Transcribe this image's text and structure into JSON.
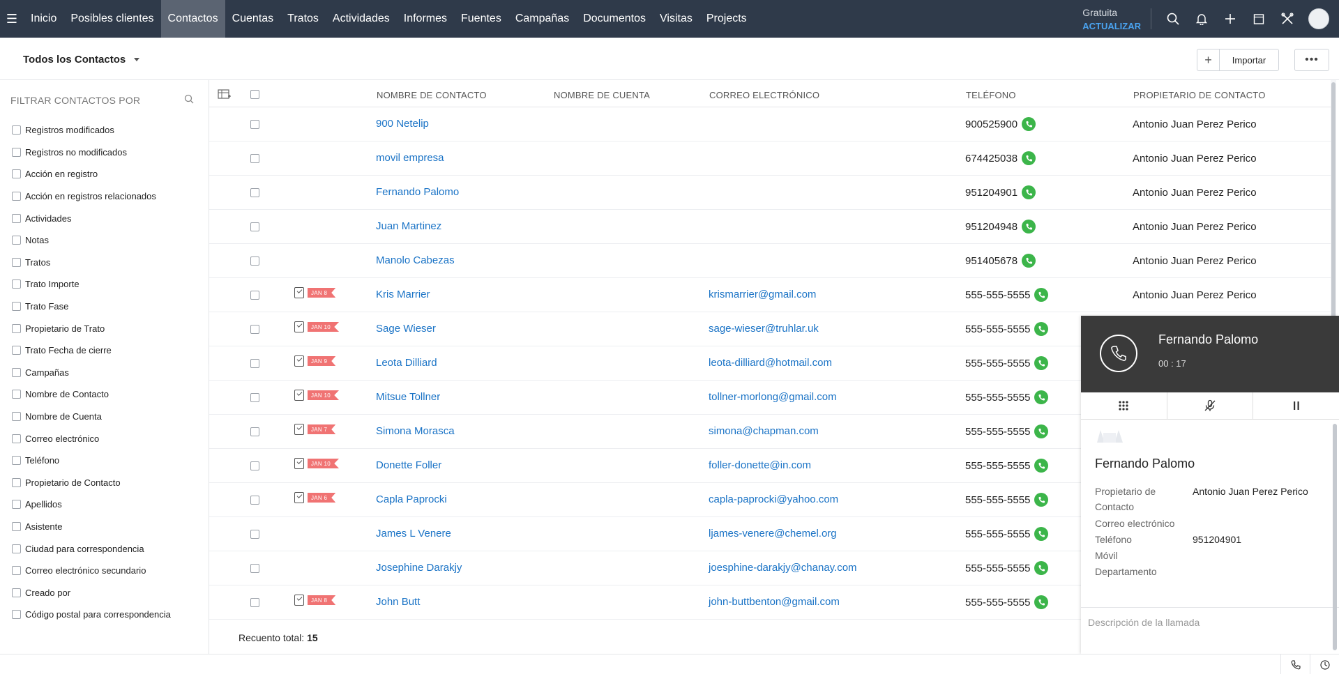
{
  "nav": {
    "tabs": [
      "Inicio",
      "Posibles clientes",
      "Contactos",
      "Cuentas",
      "Tratos",
      "Actividades",
      "Informes",
      "Fuentes",
      "Campañas",
      "Documentos",
      "Visitas",
      "Projects"
    ],
    "active_tab": "Contactos",
    "plan": "Gratuita",
    "upgrade": "ACTUALIZAR",
    "icons": [
      "search-icon",
      "bell-icon",
      "plus-icon",
      "calendar-icon",
      "tools-icon",
      "avatar"
    ]
  },
  "subheader": {
    "view_name": "Todos los Contactos",
    "import_label": "Importar",
    "plus_label": "+",
    "more_label": "•••"
  },
  "sidebar": {
    "title": "FILTRAR CONTACTOS POR",
    "filters": [
      "Registros modificados",
      "Registros no modificados",
      "Acción en registro",
      "Acción en registros relacionados",
      "Actividades",
      "Notas",
      "Tratos",
      "Trato Importe",
      "Trato Fase",
      "Propietario de Trato",
      "Trato Fecha de cierre",
      "Campañas",
      "Nombre de Contacto",
      "Nombre de Cuenta",
      "Correo electrónico",
      "Teléfono",
      "Propietario de Contacto",
      "Apellidos",
      "Asistente",
      "Ciudad para correspondencia",
      "Correo electrónico secundario",
      "Creado por",
      "Código postal para correspondencia"
    ]
  },
  "table": {
    "headers": {
      "name": "NOMBRE DE CONTACTO",
      "account": "NOMBRE DE CUENTA",
      "email": "CORREO ELECTRÓNICO",
      "phone": "TELÉFONO",
      "owner": "PROPIETARIO DE CONTACTO"
    },
    "rows": [
      {
        "name": "900 Netelip",
        "task": "",
        "email": "",
        "phone": "900525900",
        "owner": "Antonio Juan Perez Perico"
      },
      {
        "name": "movil empresa",
        "task": "",
        "email": "",
        "phone": "674425038",
        "owner": "Antonio Juan Perez Perico"
      },
      {
        "name": "Fernando Palomo",
        "task": "",
        "email": "",
        "phone": "951204901",
        "owner": "Antonio Juan Perez Perico"
      },
      {
        "name": "Juan Martinez",
        "task": "",
        "email": "",
        "phone": "951204948",
        "owner": "Antonio Juan Perez Perico"
      },
      {
        "name": "Manolo Cabezas",
        "task": "",
        "email": "",
        "phone": "951405678",
        "owner": "Antonio Juan Perez Perico"
      },
      {
        "name": "Kris Marrier",
        "task": "JAN 8",
        "email": "krismarrier@gmail.com",
        "phone": "555-555-5555",
        "owner": "Antonio Juan Perez Perico"
      },
      {
        "name": "Sage Wieser",
        "task": "JAN 10",
        "email": "sage-wieser@truhlar.uk",
        "phone": "555-555-5555",
        "owner": ""
      },
      {
        "name": "Leota Dilliard",
        "task": "JAN 9",
        "email": "leota-dilliard@hotmail.com",
        "phone": "555-555-5555",
        "owner": ""
      },
      {
        "name": "Mitsue Tollner",
        "task": "JAN 10",
        "email": "tollner-morlong@gmail.com",
        "phone": "555-555-5555",
        "owner": ""
      },
      {
        "name": "Simona Morasca",
        "task": "JAN 7",
        "email": "simona@chapman.com",
        "phone": "555-555-5555",
        "owner": ""
      },
      {
        "name": "Donette Foller",
        "task": "JAN 10",
        "email": "foller-donette@in.com",
        "phone": "555-555-5555",
        "owner": ""
      },
      {
        "name": "Capla Paprocki",
        "task": "JAN 6",
        "email": "capla-paprocki@yahoo.com",
        "phone": "555-555-5555",
        "owner": ""
      },
      {
        "name": "James L Venere",
        "task": "",
        "email": "ljames-venere@chemel.org",
        "phone": "555-555-5555",
        "owner": ""
      },
      {
        "name": "Josephine Darakjy",
        "task": "",
        "email": "joesphine-darakjy@chanay.com",
        "phone": "555-555-5555",
        "owner": ""
      },
      {
        "name": "John Butt",
        "task": "JAN 8",
        "email": "john-buttbenton@gmail.com",
        "phone": "555-555-5555",
        "owner": ""
      }
    ],
    "total_label": "Recuento total:",
    "total_value": "15"
  },
  "call_panel": {
    "caller": "Fernando Palomo",
    "timer": "00 : 17",
    "contact_name": "Fernando Palomo",
    "fields": [
      {
        "label": "Propietario de",
        "label2": "Contacto",
        "value": "Antonio Juan Perez Perico"
      },
      {
        "label": "Correo electrónico",
        "label2": "",
        "value": ""
      },
      {
        "label": "Teléfono",
        "label2": "",
        "value": "951204901"
      },
      {
        "label": "Móvil",
        "label2": "",
        "value": ""
      },
      {
        "label": "Departamento",
        "label2": "",
        "value": ""
      }
    ],
    "description_placeholder": "Descripción de la llamada"
  },
  "colors": {
    "nav_bg": "#2f3a4a",
    "link": "#1a73c6",
    "phone_green": "#3cb54a",
    "tag_red": "#f07373"
  }
}
